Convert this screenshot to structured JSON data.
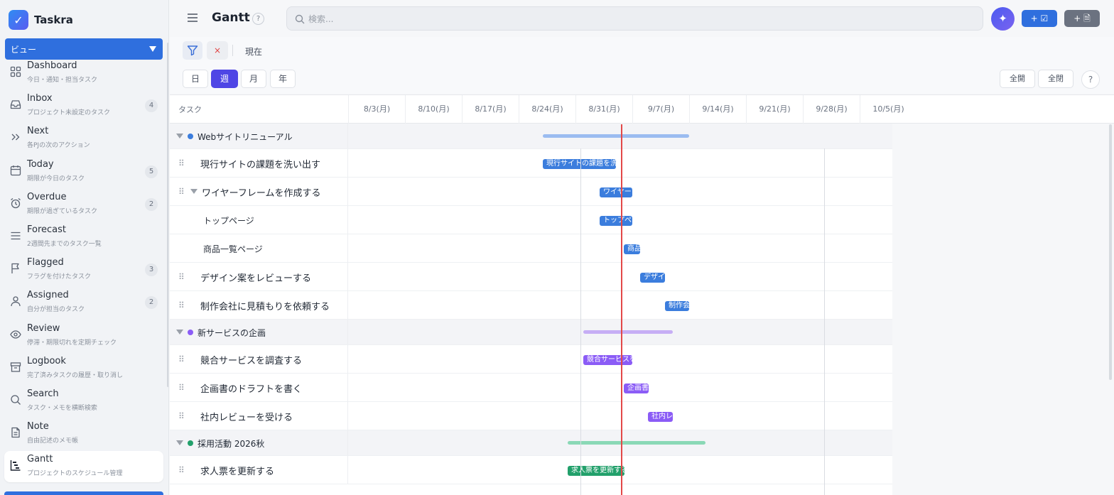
{
  "app": {
    "name": "Taskra"
  },
  "sidebar": {
    "view_label": "ビュー",
    "items": [
      {
        "id": "dashboard",
        "icon": "grid-icon",
        "title": "Dashboard",
        "subtitle": "今日・通知・担当タスク",
        "badge": ""
      },
      {
        "id": "inbox",
        "icon": "inbox-icon",
        "title": "Inbox",
        "subtitle": "プロジェクト未設定のタスク",
        "badge": "4"
      },
      {
        "id": "next",
        "icon": "double-chevron-right-icon",
        "title": "Next",
        "subtitle": "各PJの次のアクション",
        "badge": ""
      },
      {
        "id": "today",
        "icon": "calendar-icon",
        "title": "Today",
        "subtitle": "期限が今日のタスク",
        "badge": "5"
      },
      {
        "id": "overdue",
        "icon": "alarm-clock-icon",
        "title": "Overdue",
        "subtitle": "期限が過ぎているタスク",
        "badge": "2"
      },
      {
        "id": "forecast",
        "icon": "list-icon",
        "title": "Forecast",
        "subtitle": "2週間先までのタスク一覧",
        "badge": ""
      },
      {
        "id": "flagged",
        "icon": "flag-icon",
        "title": "Flagged",
        "subtitle": "フラグを付けたタスク",
        "badge": "3"
      },
      {
        "id": "assigned",
        "icon": "user-icon",
        "title": "Assigned",
        "subtitle": "自分が担当のタスク",
        "badge": "2"
      },
      {
        "id": "review",
        "icon": "eye-icon",
        "title": "Review",
        "subtitle": "停滞・期限切れを定期チェック",
        "badge": ""
      },
      {
        "id": "logbook",
        "icon": "archive-icon",
        "title": "Logbook",
        "subtitle": "完了済みタスクの履歴・取り消し",
        "badge": ""
      },
      {
        "id": "search",
        "icon": "search-icon",
        "title": "Search",
        "subtitle": "タスク・メモを横断検索",
        "badge": ""
      },
      {
        "id": "note",
        "icon": "note-icon",
        "title": "Note",
        "subtitle": "自由記述のメモ帳",
        "badge": ""
      },
      {
        "id": "gantt",
        "icon": "gantt-icon",
        "title": "Gantt",
        "subtitle": "プロジェクトのスケジュール管理",
        "badge": "",
        "active": true
      }
    ]
  },
  "header": {
    "title": "Gantt",
    "help": "?",
    "search_placeholder": "検索...",
    "ai_icon": "✦",
    "add_task_label": "+ ☑",
    "add_note_label": "+ 🗎"
  },
  "filterbar": {
    "clear": "×",
    "now_label": "現在"
  },
  "scale": {
    "buttons": [
      "日",
      "週",
      "月",
      "年"
    ],
    "active": "週",
    "expand_all": "全開",
    "collapse_all": "全閉",
    "help": "?"
  },
  "gantt": {
    "task_column_label": "タスク",
    "dates": [
      "8/3(月)",
      "8/10(月)",
      "8/17(月)",
      "8/24(月)",
      "8/31(月)",
      "9/7(月)",
      "9/14(月)",
      "9/21(月)",
      "9/28(月)",
      "10/5(月)"
    ],
    "colors": {
      "blue": "#3b7ddd",
      "blue_light": "#9bbcf0",
      "purple": "#8b5cf6",
      "purple_light": "#c6aef5",
      "green": "#22a06b",
      "green_light": "#8ad8b6",
      "today": "#e34848"
    },
    "rows": [
      {
        "type": "project",
        "name": "Webサイトリニューアル",
        "color": "#3b7ddd",
        "bar_color": "#9bbcf0"
      },
      {
        "type": "task",
        "name": "現行サイトの課題を洗い出す",
        "bar_label": "現行サイトの課題を洗い出す",
        "color": "#3b7ddd"
      },
      {
        "type": "task",
        "name": "ワイヤーフレームを作成する",
        "bar_label": "ワイヤーフレームを作成する",
        "color": "#3b7ddd",
        "expanded": true
      },
      {
        "type": "subtask",
        "name": "トップページ",
        "bar_label": "トップページ",
        "color": "#3b7ddd"
      },
      {
        "type": "subtask",
        "name": "商品一覧ページ",
        "bar_label": "商品一覧ページ",
        "color": "#3b7ddd"
      },
      {
        "type": "task",
        "name": "デザイン案をレビューする",
        "bar_label": "デザイン案をレビューする",
        "color": "#3b7ddd"
      },
      {
        "type": "task",
        "name": "制作会社に見積もりを依頼する",
        "bar_label": "制作会社に見積もりを依頼する",
        "color": "#3b7ddd"
      },
      {
        "type": "project",
        "name": "新サービスの企画",
        "color": "#8b5cf6",
        "bar_color": "#c6aef5"
      },
      {
        "type": "task",
        "name": "競合サービスを調査する",
        "bar_label": "競合サービスを調査する",
        "color": "#8b5cf6"
      },
      {
        "type": "task",
        "name": "企画書のドラフトを書く",
        "bar_label": "企画書のドラフトを書く",
        "color": "#8b5cf6"
      },
      {
        "type": "task",
        "name": "社内レビューを受ける",
        "bar_label": "社内レビューを受ける",
        "color": "#8b5cf6"
      },
      {
        "type": "project",
        "name": "採用活動 2026秋",
        "color": "#22a06b",
        "bar_color": "#8ad8b6"
      },
      {
        "type": "task",
        "name": "求人票を更新する",
        "bar_label": "求人票を更新する",
        "color": "#22a06b"
      }
    ]
  }
}
